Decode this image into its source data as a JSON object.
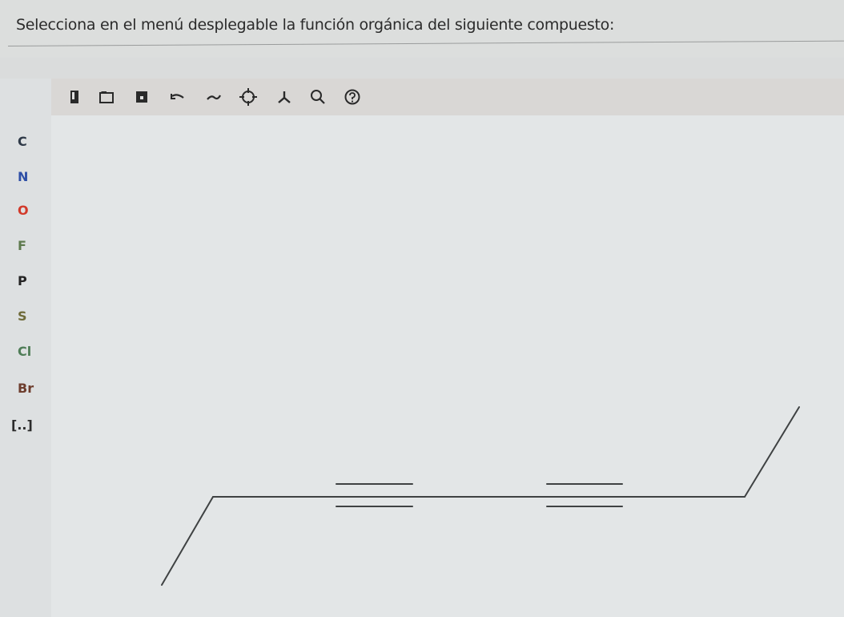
{
  "question": {
    "text": "Selecciona en el menú desplegable la función orgánica del siguiente compuesto:"
  },
  "toolbar": {
    "icons": [
      "new-document-icon",
      "open-folder-icon",
      "save-icon",
      "undo-icon",
      "redo-icon",
      "center-view-icon",
      "structure-template-icon",
      "zoom-icon",
      "help-icon"
    ]
  },
  "palette": {
    "atoms": [
      {
        "label": "C",
        "color": "#2f3a48"
      },
      {
        "label": "N",
        "color": "#2e4fa6"
      },
      {
        "label": "O",
        "color": "#d23a2a"
      },
      {
        "label": "F",
        "color": "#5e7a4e"
      },
      {
        "label": "P",
        "color": "#242424"
      },
      {
        "label": "S",
        "color": "#6f6b3a"
      },
      {
        "label": "Cl",
        "color": "#4f7d57"
      },
      {
        "label": "Br",
        "color": "#6e3e2e"
      },
      {
        "label": "[..]",
        "color": "#2b2b2b"
      }
    ]
  },
  "colors": {
    "bond": "#3f4243",
    "background": "#dcdedd"
  }
}
